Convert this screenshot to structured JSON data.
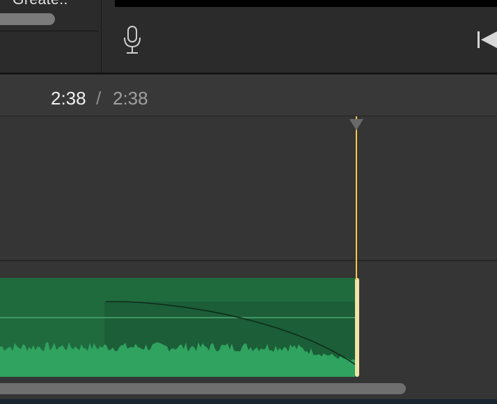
{
  "browser": {
    "item_label": "Greate.."
  },
  "timecode": {
    "current": "2:38",
    "separator": "/",
    "total": "2:38"
  },
  "timeline": {
    "clip_type": "audio",
    "playhead_color": "#f5c94a",
    "clip_color": "#1f6b3e",
    "waveform_color": "#2fa35f"
  },
  "icons": {
    "mic": "microphone-icon",
    "skip": "skip-to-start-icon",
    "playhead": "playhead-marker-icon"
  }
}
